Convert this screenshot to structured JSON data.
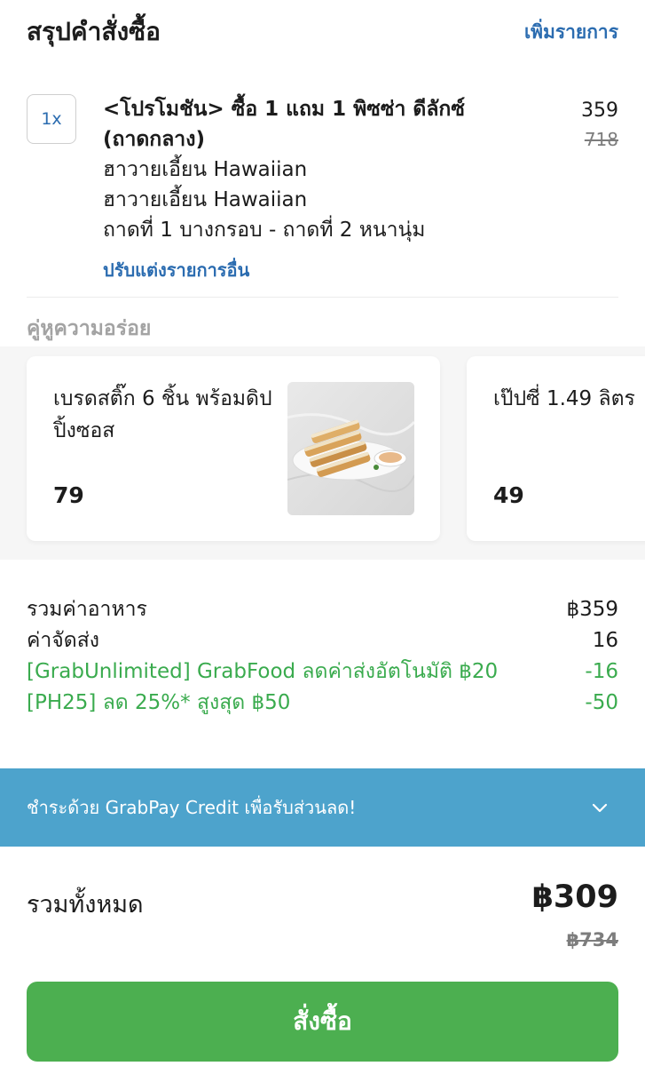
{
  "header": {
    "title": "สรุปคำสั่งซื้อ",
    "add_items_label": "เพิ่มรายการ"
  },
  "cart_item": {
    "quantity": "1x",
    "name_line1": "<โปรโมชัน> ซื้อ 1 แถม 1 พิซซ่า ดีลักซ์",
    "name_line2": "(ถาดกลาง)",
    "options": [
      "ฮาวายเอี้ยน Hawaiian",
      "ฮาวายเอี้ยน Hawaiian",
      "ถาดที่ 1 บางกรอบ - ถาดที่ 2 หนานุ่ม"
    ],
    "edit_label": "ปรับแต่งรายการอื่น",
    "price": "359",
    "original_price": "718"
  },
  "pairings": {
    "title": "คู่หูความอร่อย",
    "items": [
      {
        "name": "เบรดสติ๊ก 6 ชิ้น พร้อมดิปปิ้งซอส",
        "price": "79"
      },
      {
        "name": "เป๊ปซี่ 1.49 ลิตร",
        "price": "49"
      }
    ]
  },
  "fees": {
    "subtotal": {
      "label": "รวมค่าอาหาร",
      "value": "฿359"
    },
    "delivery": {
      "label": "ค่าจัดส่ง",
      "value": "16"
    },
    "discount_grab": {
      "label": "[GrabUnlimited] GrabFood ลดค่าส่งอัตโนมัติ ฿20",
      "value": "-16"
    },
    "discount_promo": {
      "label": "[PH25] ลด 25%* สูงสุด ฿50",
      "value": "-50"
    }
  },
  "payment_banner": {
    "text": "ชำระด้วย GrabPay Credit เพื่อรับส่วนลด!",
    "icon": "chevron-down-icon"
  },
  "total": {
    "label": "รวมทั้งหมด",
    "amount": "฿309",
    "original": "฿734"
  },
  "order_button_label": "สั่งซื้อ",
  "colors": {
    "link_blue": "#2b6cb0",
    "discount_green": "#3aab4e",
    "banner_blue": "#4da3cc",
    "button_green": "#4caf50"
  }
}
